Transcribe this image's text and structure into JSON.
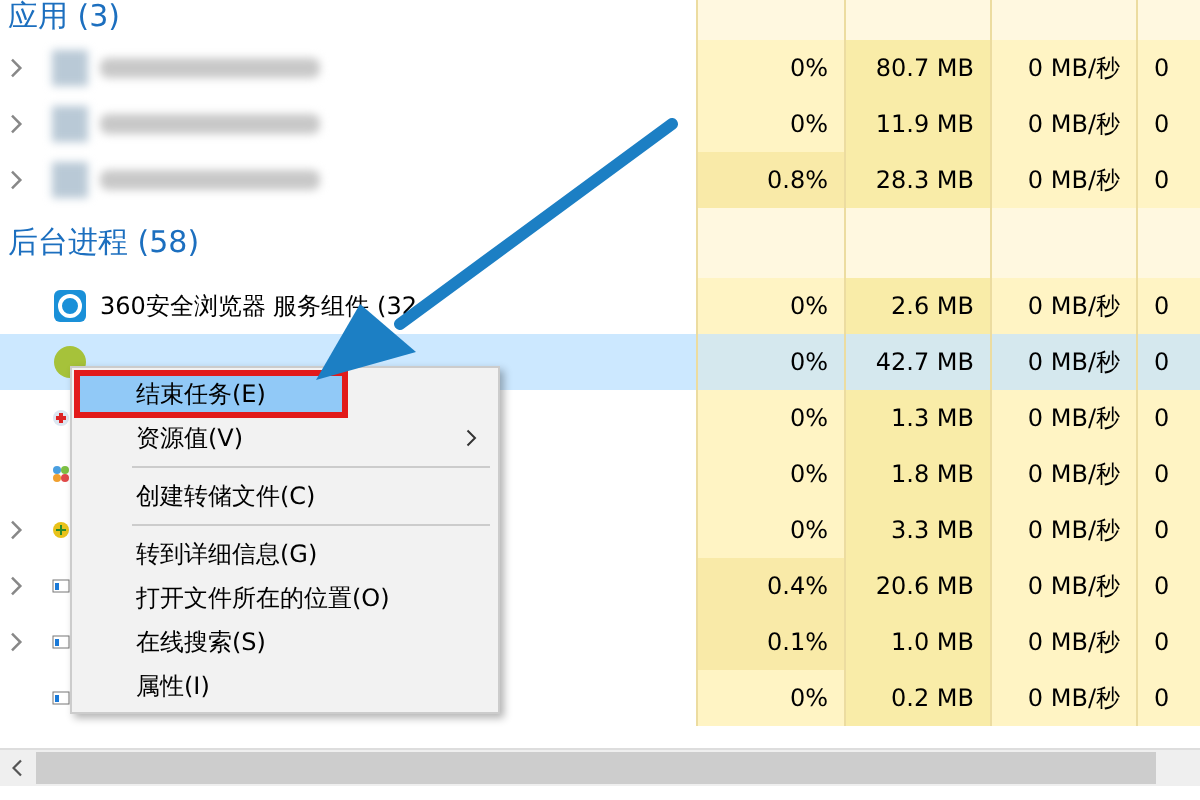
{
  "sections": [
    {
      "title": "应用 (3)",
      "rows": [
        {
          "expandable": true,
          "kind": "blurred",
          "selected": false,
          "cpu": "0%",
          "busy": false,
          "memory": "80.7 MB",
          "disk": "0 MB/秒",
          "network": "0"
        },
        {
          "expandable": true,
          "kind": "blurred",
          "selected": false,
          "cpu": "0%",
          "busy": false,
          "memory": "11.9 MB",
          "disk": "0 MB/秒",
          "network": "0"
        },
        {
          "expandable": true,
          "kind": "blurred",
          "selected": false,
          "cpu": "0.8%",
          "busy": true,
          "memory": "28.3 MB",
          "disk": "0 MB/秒",
          "network": "0"
        }
      ]
    },
    {
      "title": "后台进程 (58)",
      "rows": [
        {
          "expandable": false,
          "kind": "browser",
          "name": "360安全浏览器 服务组件 (32",
          "selected": false,
          "cpu": "0%",
          "busy": false,
          "memory": "2.6 MB",
          "disk": "0 MB/秒",
          "network": "0"
        },
        {
          "expandable": false,
          "kind": "ball",
          "selected": true,
          "cpu": "0%",
          "busy": false,
          "memory": "42.7 MB",
          "disk": "0 MB/秒",
          "network": "0"
        },
        {
          "expandable": false,
          "kind": "medical",
          "selected": false,
          "cpu": "0%",
          "busy": false,
          "memory": "1.3 MB",
          "disk": "0 MB/秒",
          "network": "0"
        },
        {
          "expandable": false,
          "kind": "people",
          "selected": false,
          "cpu": "0%",
          "busy": false,
          "memory": "1.8 MB",
          "disk": "0 MB/秒",
          "network": "0"
        },
        {
          "expandable": true,
          "kind": "plus",
          "selected": false,
          "cpu": "0%",
          "busy": false,
          "memory": "3.3 MB",
          "disk": "0 MB/秒",
          "network": "0"
        },
        {
          "expandable": true,
          "kind": "window",
          "selected": false,
          "cpu": "0.4%",
          "busy": true,
          "memory": "20.6 MB",
          "disk": "0 MB/秒",
          "network": "0"
        },
        {
          "expandable": true,
          "kind": "window",
          "selected": false,
          "cpu": "0.1%",
          "busy": true,
          "memory": "1.0 MB",
          "disk": "0 MB/秒",
          "network": "0"
        },
        {
          "expandable": false,
          "kind": "window",
          "selected": false,
          "cpu": "0%",
          "busy": false,
          "memory": "0.2 MB",
          "disk": "0 MB/秒",
          "network": "0"
        }
      ]
    }
  ],
  "context_menu": {
    "items": [
      {
        "kind": "item",
        "label": "结束任务(E)",
        "selected": true,
        "highlighted_by_annotation": true,
        "submenu": false
      },
      {
        "kind": "item",
        "label": "资源值(V)",
        "selected": false,
        "highlighted_by_annotation": false,
        "submenu": true
      },
      {
        "kind": "separator"
      },
      {
        "kind": "item",
        "label": "创建转储文件(C)",
        "selected": false,
        "highlighted_by_annotation": false,
        "submenu": false
      },
      {
        "kind": "separator"
      },
      {
        "kind": "item",
        "label": "转到详细信息(G)",
        "selected": false,
        "highlighted_by_annotation": false,
        "submenu": false
      },
      {
        "kind": "item",
        "label": "打开文件所在的位置(O)",
        "selected": false,
        "highlighted_by_annotation": false,
        "submenu": false
      },
      {
        "kind": "item",
        "label": "在线搜索(S)",
        "selected": false,
        "highlighted_by_annotation": false,
        "submenu": false
      },
      {
        "kind": "item",
        "label": "属性(I)",
        "selected": false,
        "highlighted_by_annotation": false,
        "submenu": false
      }
    ]
  }
}
